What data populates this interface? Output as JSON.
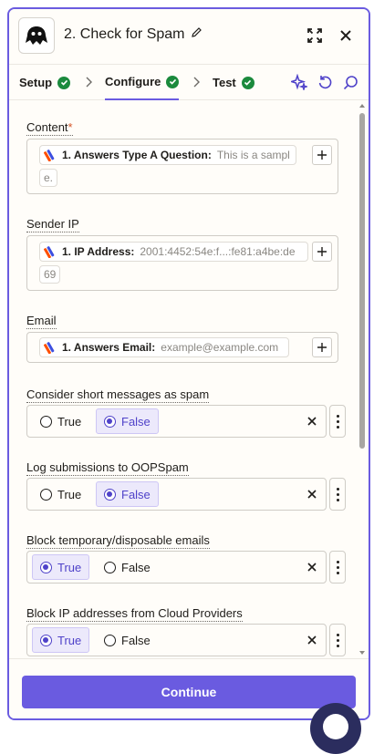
{
  "header": {
    "step_title": "2. Check for Spam",
    "icons": {
      "logo": "ghost-logo-icon",
      "edit": "pencil-icon",
      "expand": "expand-icon",
      "close": "close-icon"
    }
  },
  "tabs": [
    {
      "label": "Setup",
      "status": "complete"
    },
    {
      "label": "Configure",
      "status": "complete",
      "active": true
    },
    {
      "label": "Test",
      "status": "complete"
    }
  ],
  "toolbar": {
    "icons": [
      "sparkle-icon",
      "refresh-icon",
      "search-icon"
    ]
  },
  "fields": {
    "content": {
      "label": "Content",
      "required_mark": "*",
      "token_name": "1. Answers Type A Question:",
      "token_value": "This is a sampl",
      "overflow_text": "e."
    },
    "sender_ip": {
      "label": "Sender IP",
      "token_name": "1. IP Address:",
      "token_value": "2001:4452:54e:f...:fe81:a4be:de",
      "overflow_text": "69"
    },
    "email": {
      "label": "Email",
      "token_name": "1. Answers Email:",
      "token_value": "example@example.com"
    }
  },
  "radio_fields": [
    {
      "label": "Consider short messages as spam",
      "options": [
        "True",
        "False"
      ],
      "selected": "False"
    },
    {
      "label": "Log submissions to OOPSpam",
      "options": [
        "True",
        "False"
      ],
      "selected": "False"
    },
    {
      "label": "Block temporary/disposable emails",
      "options": [
        "True",
        "False"
      ],
      "selected": "True"
    },
    {
      "label": "Block IP addresses from Cloud Providers",
      "options": [
        "True",
        "False"
      ],
      "selected": "True"
    }
  ],
  "footer": {
    "continue_label": "Continue"
  },
  "colors": {
    "accent": "#6a5be0",
    "success": "#1b8a3d",
    "required": "#d5562a"
  }
}
